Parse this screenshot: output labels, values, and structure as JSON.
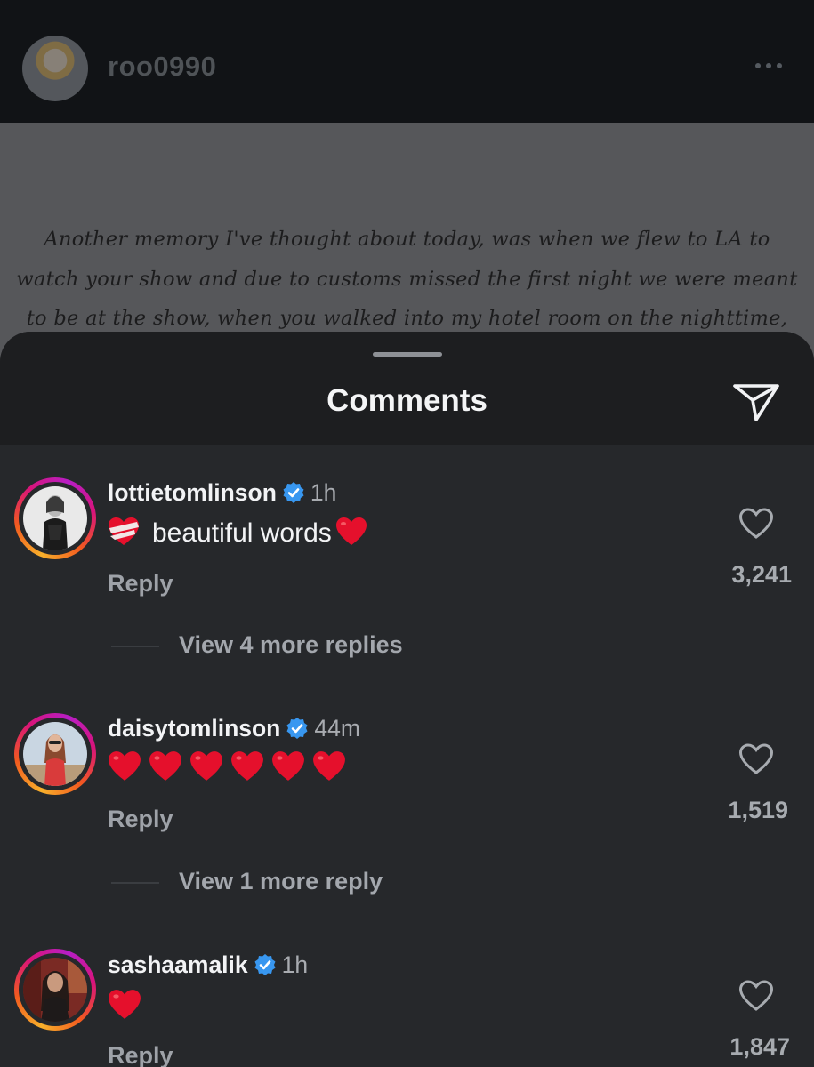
{
  "header": {
    "username": "roo0990"
  },
  "post": {
    "lines": [
      "Another memory I've thought about today, was when we flew to LA to",
      "watch your show and due to customs missed the first night we were meant",
      "to be at the show, when you walked into my hotel room on the nighttime,"
    ]
  },
  "comments_sheet": {
    "title": "Comments",
    "comments": [
      {
        "username": "lottietomlinson",
        "time": "1h",
        "text": "beautiful words",
        "reply_label": "Reply",
        "likes": "3,241",
        "more_replies": "View 4 more replies"
      },
      {
        "username": "daisytomlinson",
        "time": "44m",
        "text": "",
        "reply_label": "Reply",
        "likes": "1,519",
        "more_replies": "View 1 more reply"
      },
      {
        "username": "sashaamalik",
        "time": "1h",
        "text": "",
        "reply_label": "Reply",
        "likes": "1,847"
      }
    ]
  },
  "colors": {
    "background": "#26282b",
    "header_bg": "#1d1e20",
    "verified_blue": "#3897f0",
    "heart_red": "#e5102c"
  }
}
